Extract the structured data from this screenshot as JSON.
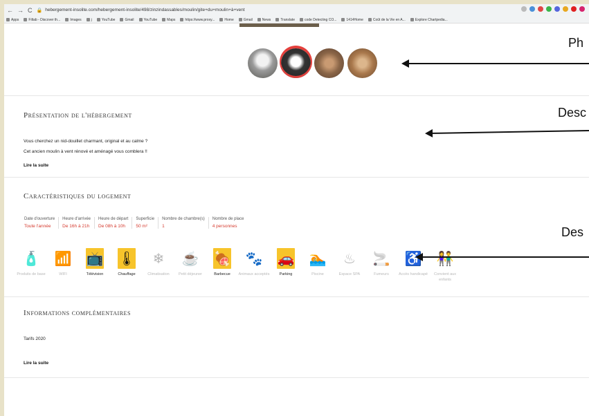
{
  "browser": {
    "url": "hebergement-insolite.com/hebergement-insolite/498/zinzindassables/moulin/gite+du+moulin+à+vent",
    "bookmarks": [
      "Apps",
      "Filtab - Discover th...",
      "Images",
      "j",
      "YouTube",
      "Gmail",
      "YouTube",
      "Maps",
      "https://www.proxy...",
      "Home",
      "Gmail",
      "News",
      "Translate",
      "code Detecting CO...",
      "1414Home",
      "Coût de la Vie en A...",
      "Explore Chartpedia..."
    ]
  },
  "annotations": {
    "photos": "Ph",
    "description": "Desc",
    "features": "Des"
  },
  "presentation": {
    "title": "Présentation de l'hébergement",
    "line1": "Vous cherchez un nid-douillet charmant, original et au calme ?",
    "line2": "Cet ancien moulin à vent rénové et aménagé vous comblera !!",
    "more": "Lire la suite"
  },
  "characteristics": {
    "title": "Caractéristiques du logement",
    "columns": [
      {
        "label": "Date d'ouverture",
        "value": "Toute l'année"
      },
      {
        "label": "Heure d'arrivée",
        "value": "De 16h à 21h"
      },
      {
        "label": "Heure de départ",
        "value": "De 08h à 10h"
      },
      {
        "label": "Superficie",
        "value": "50 m²"
      },
      {
        "label": "Nombre de chambre(s)",
        "value": "1"
      },
      {
        "label": "Nombre de place",
        "value": "4 personnes"
      }
    ],
    "amenities": [
      {
        "name": "basic-products-icon",
        "glyph": "🧴",
        "label": "Produits de base",
        "on": false
      },
      {
        "name": "wifi-icon",
        "glyph": "📶",
        "label": "WIFI",
        "on": false
      },
      {
        "name": "tv-icon",
        "glyph": "📺",
        "label": "Télévision",
        "on": true
      },
      {
        "name": "heating-icon",
        "glyph": "🌡",
        "label": "Chauffage",
        "on": true
      },
      {
        "name": "air-conditioning-icon",
        "glyph": "❄",
        "label": "Climatisation",
        "on": false
      },
      {
        "name": "breakfast-icon",
        "glyph": "☕",
        "label": "Petit déjeuner",
        "on": false
      },
      {
        "name": "barbecue-icon",
        "glyph": "🍖",
        "label": "Barbecue",
        "on": true
      },
      {
        "name": "pets-icon",
        "glyph": "🐾",
        "label": "Animaux acceptés",
        "on": false
      },
      {
        "name": "parking-icon",
        "glyph": "🚗",
        "label": "Parking",
        "on": true
      },
      {
        "name": "pool-icon",
        "glyph": "🏊",
        "label": "Piscine",
        "on": false
      },
      {
        "name": "spa-icon",
        "glyph": "♨",
        "label": "Espace SPA",
        "on": false
      },
      {
        "name": "smokers-icon",
        "glyph": "🚬",
        "label": "Fumeurs",
        "on": false
      },
      {
        "name": "accessibility-icon",
        "glyph": "♿",
        "label": "Accès handicapé",
        "on": false
      },
      {
        "name": "children-icon",
        "glyph": "👫",
        "label": "Convient aux enfants",
        "on": false
      }
    ]
  },
  "info": {
    "title": "Informations complémentaires",
    "tarifs": "Tarifs 2020",
    "more": "Lire la suite"
  }
}
